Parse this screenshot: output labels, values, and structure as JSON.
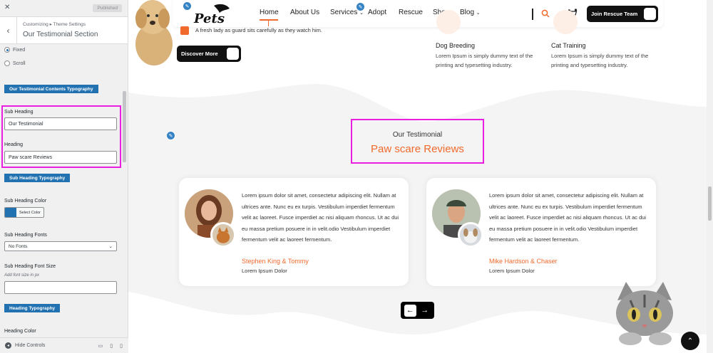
{
  "customizer": {
    "published_label": "Published",
    "breadcrumb": "Customizing ▸ Theme Settings",
    "section_title": "Our Testimonial Section",
    "radio_fixed": "Fixed",
    "radio_scroll": "Scroll",
    "contents_typography_btn": "Our Testimonial Contents Typography",
    "sub_heading_label": "Sub Heading",
    "sub_heading_value": "Our Testimonial",
    "heading_label": "Heading",
    "heading_value": "Paw scare Reviews",
    "sub_heading_typography_btn": "Sub Heading Typography",
    "sub_heading_color_label": "Sub Heading Color",
    "select_color_label": "Select Color",
    "sub_heading_fonts_label": "Sub Heading Fonts",
    "fonts_selected": "No Fonts",
    "font_size_label": "Sub Heading Font Size",
    "font_size_desc": "Add font size in px",
    "heading_typography_btn": "Heading Typography",
    "heading_color_label": "Heading Color",
    "hide_controls": "Hide Controls"
  },
  "nav": {
    "items": [
      "Home",
      "About Us",
      "Services",
      "Adopt",
      "Rescue",
      "Shop",
      "Blog"
    ],
    "join_button": "Join Rescue Team"
  },
  "logo_text": "Pets",
  "feature_text": "A fresh lady as guard sits carefully as they watch him.",
  "discover_button": "Discover More",
  "services": [
    {
      "title": "Dog Breeding",
      "desc": "Lorem Ipsum is simply dummy text of the printing and typesetting industry."
    },
    {
      "title": "Cat Training",
      "desc": "Lorem Ipsum is simply dummy text of the printing and typesetting industry."
    }
  ],
  "testimonial": {
    "sub_heading": "Our Testimonial",
    "heading": "Paw scare Reviews"
  },
  "cards": [
    {
      "quote": "Lorem ipsum dolor sit amet, consectetur adipiscing elit. Nullam at ultrices ante. Nunc eu ex turpis. Vestibulum imperdiet fermentum velit ac laoreet. Fusce imperdiet ac nisi aliquam rhoncus. Ut ac dui eu massa pretium posuere in in velit.odio Vestibulum imperdiet fermentum velit ac laoreet fermentum.",
      "name": "Stephen King & Tommy",
      "role": "Lorem Ipsum Dolor"
    },
    {
      "quote": "Lorem ipsum dolor sit amet, consectetur adipiscing elit. Nullam at ultrices ante. Nunc eu ex turpis. Vestibulum imperdiet fermentum velit ac laoreet. Fusce imperdiet ac nisi aliquam rhoncus. Ut ac dui eu massa pretium posuere in in velit.odio Vestibulum imperdiet fermentum velit ac laoreet fermentum.",
      "name": "Mike Hardson & Chaser",
      "role": "Lorem Ipsum Dolor"
    }
  ],
  "colors": {
    "accent": "#f06a2d",
    "highlight": "#e91ee0",
    "wp_blue": "#2271b1"
  }
}
